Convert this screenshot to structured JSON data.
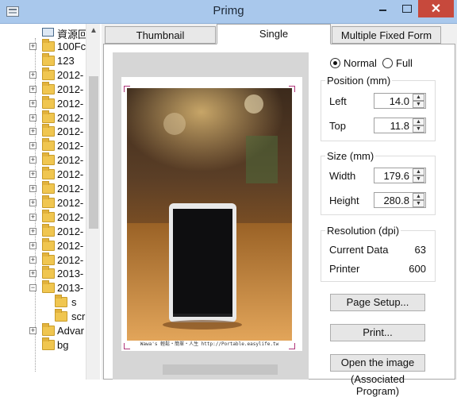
{
  "window": {
    "title": "Primg",
    "close_glyph": "✕"
  },
  "tree": {
    "root_label": "資源回",
    "items": [
      {
        "label": "100Fc",
        "expandable": true
      },
      {
        "label": "123",
        "expandable": false
      },
      {
        "label": "2012-",
        "expandable": true
      },
      {
        "label": "2012-",
        "expandable": true
      },
      {
        "label": "2012-",
        "expandable": true
      },
      {
        "label": "2012-",
        "expandable": true
      },
      {
        "label": "2012-",
        "expandable": true
      },
      {
        "label": "2012-",
        "expandable": true
      },
      {
        "label": "2012-",
        "expandable": true
      },
      {
        "label": "2012-",
        "expandable": true
      },
      {
        "label": "2012-",
        "expandable": true
      },
      {
        "label": "2012-",
        "expandable": true
      },
      {
        "label": "2012-",
        "expandable": true
      },
      {
        "label": "2012-",
        "expandable": true
      },
      {
        "label": "2012-",
        "expandable": true
      },
      {
        "label": "2012-",
        "expandable": true
      },
      {
        "label": "2013-",
        "expandable": true
      },
      {
        "label": "2013-",
        "expandable": true,
        "expanded": true
      },
      {
        "label": "s",
        "child": true
      },
      {
        "label": "scr",
        "child": true
      },
      {
        "label": "Advar",
        "expandable": true
      },
      {
        "label": "bg",
        "expandable": false
      }
    ]
  },
  "tabs": [
    {
      "label": "Thumbnail"
    },
    {
      "label": "Single",
      "active": true
    },
    {
      "label": "Multiple Fixed Form"
    }
  ],
  "preview": {
    "caption": "Wawa's 輕鬆・簡單・人生 http://Portable.easylife.tw"
  },
  "mode": {
    "normal_label": "Normal",
    "full_label": "Full",
    "selected": "normal"
  },
  "position": {
    "title": "Position (mm)",
    "left_label": "Left",
    "left_value": "14.0",
    "top_label": "Top",
    "top_value": "11.8"
  },
  "size": {
    "title": "Size (mm)",
    "width_label": "Width",
    "width_value": "179.6",
    "height_label": "Height",
    "height_value": "280.8"
  },
  "resolution": {
    "title": "Resolution (dpi)",
    "current_label": "Current Data",
    "current_value": "63",
    "printer_label": "Printer",
    "printer_value": "600"
  },
  "buttons": {
    "page_setup": "Page Setup...",
    "print": "Print...",
    "open_image": "Open the image",
    "cut_text": "(Associated Program)"
  },
  "icons": {
    "app": "app-window-icon",
    "folder": "folder-icon",
    "computer": "computer-icon"
  }
}
